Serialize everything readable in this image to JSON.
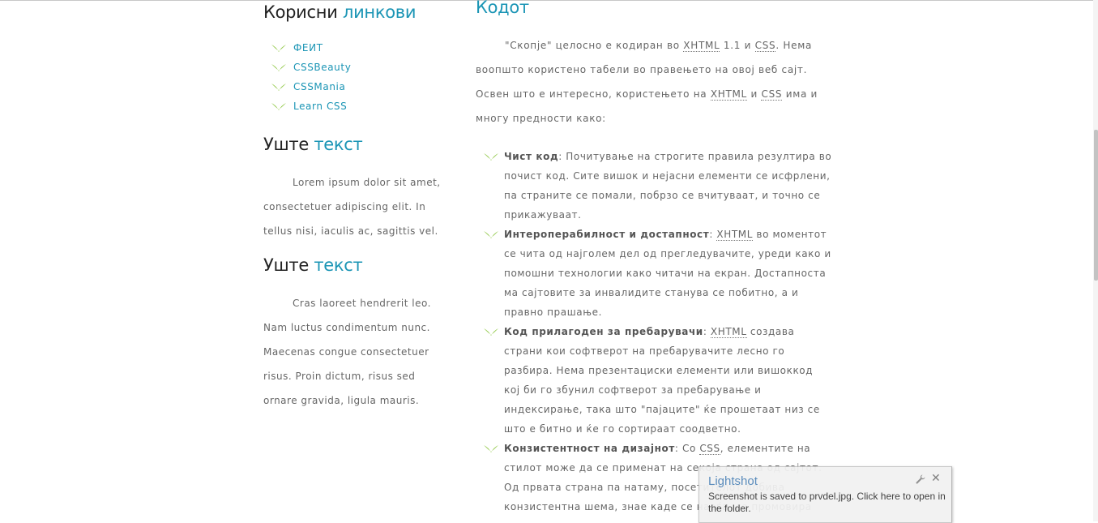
{
  "left": {
    "useful_links": {
      "title_plain": "Корисни",
      "title_highlight": "линкови",
      "links": [
        "ФЕИТ",
        "CSSBeauty",
        "CSSMania",
        "Learn CSS"
      ]
    },
    "more_text_1": {
      "title_plain": "Уште",
      "title_highlight": "текст",
      "body": "Lorem ipsum dolor sit amet, consectetuer adipiscing elit. In tellus nisi, iaculis ac, sagittis vel."
    },
    "more_text_2": {
      "title_plain": "Уште",
      "title_highlight": "текст",
      "body": "Cras laoreet hendrerit leo. Nam luctus condimentum nunc. Maecenas congue consectetuer risus. Proin dictum, risus sed ornare gravida, ligula mauris."
    }
  },
  "right": {
    "title": "Кодот",
    "intro": {
      "p1": "\"Скопје\" целосно е кодиран во ",
      "xhtml": "XHTML",
      "p2": " 1.1 и ",
      "css": "CSS",
      "p3": ". Нема воопшто користено табели во правењето на овој веб сајт. Освен што е интересно, користењето на ",
      "p4": " и ",
      "p5": " има и многу предности како:"
    },
    "features": [
      {
        "bold": "Чист код",
        "text": ": Почитување на строгите правила резултира во почист код. Сите вишок и нејасни елементи се исфрлени, па страните се помали, побрзо се вчитуваат, и точно се прикажуваат."
      },
      {
        "bold": "Интероперабилност и достапност",
        "pre": ": ",
        "abbr": "XHTML",
        "text": " во моментот се чита од најголем дел од прегледувачите, уреди како и помошни технологии како читачи на екран. Достапноста ма сајтовите за инвалидите станува се побитно, а и правно прашање."
      },
      {
        "bold": "Код прилагоден за пребарувачи",
        "pre": ": ",
        "abbr": "XHTML",
        "text": " создава страни кои софтверот на пребарувачите лесно го разбира. Нема презентациски елементи или вишоккод кој би го збунил софтверот за пребарување и индексирање, така што \"пајаците\" ќе прошетаат низ се што е битно и ќе го сортираат соодветно."
      },
      {
        "bold": "Конзистентност на дизајнот",
        "pre": ": Со ",
        "abbr": "CSS",
        "text": ", елементите на стилот може да се применат на секоја страна од сајтот. Од првата страна па натаму, посетителот добива конзистентна шема, знае каде се наоѓа, се промовира"
      }
    ]
  },
  "toast": {
    "title": "Lightshot",
    "message": "Screenshot is saved to prvdel.jpg. Click here to open in the folder.",
    "close": "✕",
    "wrench_icon": "wrench-icon"
  },
  "colors": {
    "accent": "#1b95b5",
    "bullet": "#8cc63f",
    "text": "#666666"
  }
}
